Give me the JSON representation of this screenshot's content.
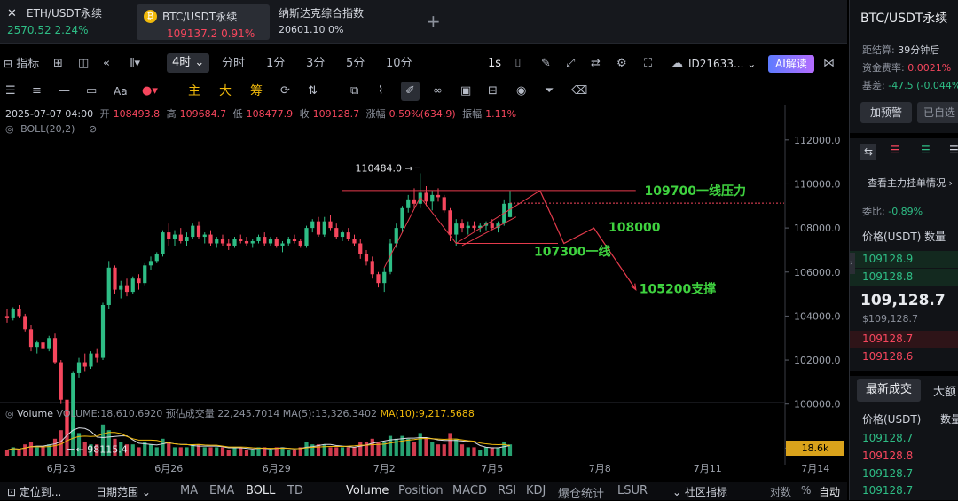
{
  "tabs": [
    {
      "name": "ETH/USDT永续",
      "price": "2570.52",
      "change": "2.24%"
    },
    {
      "name": "BTC/USDT永续",
      "price": "109137.2",
      "change": "0.91%"
    },
    {
      "name": "纳斯达克综合指数",
      "price": "20601.10",
      "change": "0%"
    }
  ],
  "toolbar": {
    "indicator": "指标",
    "interval_active": "4时",
    "intervals": [
      "分时",
      "1分",
      "3分",
      "5分",
      "10分"
    ],
    "refresh": "1s",
    "account_id": "ID21633...",
    "ai_button": "AI解读"
  },
  "drawing_tools": {
    "main": "主",
    "big": "大",
    "chips": "筹"
  },
  "candle_info": {
    "date": "2025-07-07 04:00",
    "open_label": "开",
    "open": "108493.8",
    "high_label": "高",
    "high": "109684.7",
    "low_label": "低",
    "low": "108477.9",
    "close_label": "收",
    "close": "109128.7",
    "chg_label": "涨幅",
    "chg": "0.59%(634.9)",
    "amp_label": "振幅",
    "amp": "1.11%",
    "boll": "BOLL(20,2)"
  },
  "volume_info": {
    "label": "Volume",
    "vol": "VOLUME:18,610.6920",
    "est": "预估成交量 22,245.7014",
    "ma5": "MA(5):13,326.3402",
    "ma10": "MA(10):9,217.5688",
    "badge": "18.6k"
  },
  "chart_data": {
    "type": "candlestick",
    "y_ticks": [
      "112000.0",
      "110000.0",
      "108000.0",
      "106000.0",
      "104000.0",
      "102000.0",
      "100000.0",
      "98000.0"
    ],
    "ylim": [
      96000,
      113000
    ],
    "x_ticks": [
      "6月23",
      "6月26",
      "6月29",
      "7月2",
      "7月5",
      "7月8",
      "7月11",
      "7月14"
    ],
    "low_marker": "98115.4",
    "high_marker": "110484.0",
    "current_price_label": "109128.7",
    "annotations": [
      {
        "text": "109700一线压力",
        "value": 109700
      },
      {
        "text": "108000",
        "value": 108000
      },
      {
        "text": "107300一线",
        "value": 107300
      },
      {
        "text": "105200支撑",
        "value": 105200
      }
    ],
    "candles": [
      [
        104000,
        104300,
        103700,
        103900
      ],
      [
        103900,
        104400,
        103800,
        104300
      ],
      [
        104300,
        104500,
        103900,
        104000
      ],
      [
        104000,
        104100,
        103300,
        103400
      ],
      [
        103400,
        103600,
        102400,
        102600
      ],
      [
        102600,
        102900,
        102300,
        102800
      ],
      [
        102800,
        103000,
        102400,
        102500
      ],
      [
        102500,
        103100,
        102400,
        103000
      ],
      [
        103000,
        103200,
        101800,
        101900
      ],
      [
        101900,
        102000,
        100000,
        100200
      ],
      [
        100200,
        100400,
        98115,
        98600
      ],
      [
        98600,
        101500,
        98400,
        101400
      ],
      [
        101400,
        102100,
        101200,
        101900
      ],
      [
        101900,
        102300,
        101500,
        101700
      ],
      [
        101700,
        102400,
        101600,
        102300
      ],
      [
        102300,
        102500,
        101900,
        102100
      ],
      [
        102100,
        104600,
        102000,
        104500
      ],
      [
        104500,
        106500,
        104300,
        106200
      ],
      [
        106200,
        106300,
        105000,
        105200
      ],
      [
        105200,
        105600,
        104800,
        105400
      ],
      [
        105400,
        105700,
        104900,
        105100
      ],
      [
        105100,
        105800,
        105000,
        105700
      ],
      [
        105700,
        105900,
        105200,
        105500
      ],
      [
        105500,
        106400,
        105400,
        106300
      ],
      [
        106300,
        106700,
        106100,
        106500
      ],
      [
        106500,
        106900,
        106400,
        106800
      ],
      [
        106800,
        107900,
        106700,
        107800
      ],
      [
        107800,
        108200,
        107200,
        107500
      ],
      [
        107500,
        107900,
        107200,
        107700
      ],
      [
        107700,
        108000,
        107300,
        107400
      ],
      [
        107400,
        107800,
        107200,
        107600
      ],
      [
        107600,
        108200,
        107500,
        108100
      ],
      [
        108100,
        108300,
        107500,
        107600
      ],
      [
        107600,
        107800,
        107300,
        107700
      ],
      [
        107700,
        107900,
        107200,
        107300
      ],
      [
        107300,
        107600,
        107100,
        107500
      ],
      [
        107500,
        107700,
        107200,
        107300
      ],
      [
        107300,
        107500,
        107000,
        107200
      ],
      [
        107200,
        107600,
        107100,
        107500
      ],
      [
        107500,
        107700,
        107300,
        107400
      ],
      [
        107400,
        107600,
        107200,
        107300
      ],
      [
        107300,
        107500,
        107100,
        107400
      ],
      [
        107400,
        107700,
        107300,
        107600
      ],
      [
        107600,
        107800,
        107200,
        107300
      ],
      [
        107300,
        107600,
        107200,
        107500
      ],
      [
        107500,
        107600,
        107100,
        107200
      ],
      [
        107200,
        107400,
        106900,
        107300
      ],
      [
        107300,
        107600,
        107200,
        107500
      ],
      [
        107500,
        107700,
        107300,
        107400
      ],
      [
        107400,
        107500,
        107100,
        107200
      ],
      [
        107200,
        108100,
        107100,
        108000
      ],
      [
        108000,
        108400,
        107800,
        108300
      ],
      [
        108300,
        108500,
        107600,
        107700
      ],
      [
        107700,
        108500,
        107600,
        108300
      ],
      [
        108300,
        108600,
        107900,
        108000
      ],
      [
        108000,
        108200,
        107500,
        107600
      ],
      [
        107600,
        107900,
        107400,
        107800
      ],
      [
        107800,
        108000,
        107400,
        107500
      ],
      [
        107500,
        107700,
        107200,
        107300
      ],
      [
        107300,
        107500,
        106600,
        106800
      ],
      [
        106800,
        107000,
        106300,
        106500
      ],
      [
        106500,
        106700,
        105700,
        105900
      ],
      [
        105900,
        106000,
        105300,
        105500
      ],
      [
        105500,
        106200,
        105100,
        106000
      ],
      [
        106000,
        107500,
        105900,
        107300
      ],
      [
        107300,
        108200,
        107100,
        108000
      ],
      [
        108000,
        109000,
        107800,
        108900
      ],
      [
        108900,
        109500,
        108700,
        109300
      ],
      [
        109300,
        109800,
        108900,
        109100
      ],
      [
        109100,
        110484,
        108900,
        109600
      ],
      [
        109600,
        109900,
        109000,
        109200
      ],
      [
        109200,
        109700,
        108800,
        109500
      ],
      [
        109500,
        109800,
        109200,
        109400
      ],
      [
        109400,
        109500,
        108700,
        108800
      ],
      [
        108800,
        108900,
        107400,
        107700
      ],
      [
        107700,
        108400,
        107200,
        108200
      ],
      [
        108200,
        108400,
        107800,
        108000
      ],
      [
        108000,
        108300,
        107700,
        108100
      ],
      [
        108100,
        108300,
        107900,
        108000
      ],
      [
        108000,
        108200,
        107800,
        108100
      ],
      [
        108100,
        108300,
        107900,
        108200
      ],
      [
        108200,
        108400,
        107900,
        108000
      ],
      [
        108000,
        108300,
        107800,
        108200
      ],
      [
        108200,
        109300,
        108100,
        109100
      ],
      [
        108494,
        109685,
        108478,
        109129
      ]
    ],
    "volumes": [
      2,
      3,
      2,
      4,
      5,
      3,
      3,
      4,
      6,
      9,
      14,
      12,
      8,
      5,
      4,
      4,
      11,
      9,
      6,
      5,
      4,
      4,
      3,
      5,
      4,
      3,
      6,
      5,
      3,
      3,
      3,
      4,
      4,
      3,
      3,
      3,
      3,
      2,
      3,
      3,
      2,
      2,
      3,
      3,
      2,
      3,
      3,
      2,
      2,
      3,
      5,
      4,
      4,
      4,
      3,
      3,
      3,
      3,
      3,
      5,
      5,
      6,
      5,
      5,
      7,
      6,
      7,
      6,
      5,
      8,
      6,
      5,
      4,
      4,
      8,
      6,
      4,
      3,
      3,
      2,
      3,
      3,
      3,
      5,
      4
    ]
  },
  "sidebar": {
    "title": "BTC/USDT永续",
    "settle_label": "距结算:",
    "settle_value": "39分钟后",
    "funding_label": "资金费率:",
    "funding_value": "0.0021%",
    "basis_label": "基差:",
    "basis_value": "-47.5 (-0.044%",
    "btn_preorder": "加预警",
    "btn_added": "已自选",
    "depth_link": "查看主力挂单情况",
    "ratio_label": "委比:",
    "ratio_value": "-0.89%",
    "col_price": "价格(USDT)",
    "col_qty": "数量",
    "asks": [
      "109128.9",
      "109128.8"
    ],
    "last_price": "109,128.7",
    "last_price_usd": "$109,128.7",
    "bids": [
      "109128.7",
      "109128.6"
    ],
    "tab_trades": "最新成交",
    "tab_big": "大额",
    "trades_col_price": "价格(USDT)",
    "trades_col_qty": "数量",
    "trades": [
      {
        "p": "109128.7",
        "c": "green"
      },
      {
        "p": "109128.8",
        "c": "red"
      },
      {
        "p": "109128.7",
        "c": "green"
      },
      {
        "p": "109128.7",
        "c": "green"
      }
    ]
  },
  "bottom_bar": {
    "locate": "定位到...",
    "date_range": "日期范围",
    "overlays": [
      "MA",
      "EMA",
      "BOLL",
      "TD"
    ],
    "subplots": [
      "Volume",
      "Position",
      "MACD",
      "RSI",
      "KDJ",
      "爆仓统计",
      "LSUR"
    ],
    "community": "社区指标",
    "log": "对数",
    "pct": "%",
    "auto": "自动",
    "corner_chips": "筹",
    "corner_burst": "爆"
  }
}
